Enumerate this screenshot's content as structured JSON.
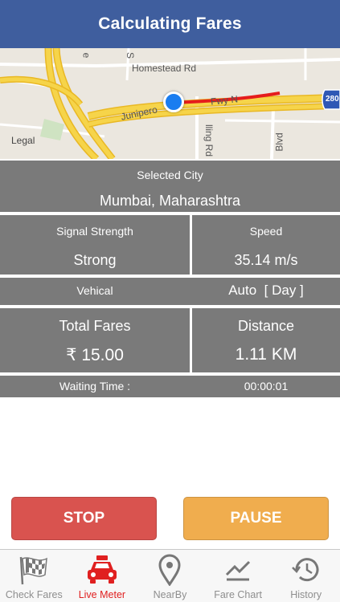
{
  "header": {
    "title": "Calculating Fares"
  },
  "map": {
    "labels": {
      "homestead": "Homestead Rd",
      "junipero": "Junipero",
      "fwy": "Fwy N",
      "rd": "lling Rd",
      "blvd": "Blvd",
      "s": "S",
      "e": "e",
      "route": "280"
    },
    "legal": "Legal"
  },
  "info": {
    "selected_city_label": "Selected City",
    "selected_city_value": "Mumbai, Maharashtra",
    "signal_label": "Signal Strength",
    "signal_value": "Strong",
    "speed_label": "Speed",
    "speed_value": "35.14 m/s",
    "vehicle_label": "Vehical",
    "vehicle_value": "Auto  [ Day ]",
    "total_fares_label": "Total Fares",
    "total_fares_value": "₹ 15.00",
    "distance_label": "Distance",
    "distance_value": "1.11 KM",
    "waiting_label": "Waiting Time :",
    "waiting_value": "00:00:01"
  },
  "buttons": {
    "stop": "STOP",
    "pause": "PAUSE"
  },
  "tabs": [
    {
      "label": "Check Fares",
      "icon": "checkered-flag-icon"
    },
    {
      "label": "Live Meter",
      "icon": "taxi-icon",
      "active": true
    },
    {
      "label": "NearBy",
      "icon": "location-pin-icon"
    },
    {
      "label": "Fare Chart",
      "icon": "chart-icon"
    },
    {
      "label": "History",
      "icon": "history-clock-icon"
    }
  ],
  "colors": {
    "header": "#3f5e9e",
    "cell": "#7a7a7a",
    "stop": "#d9534f",
    "pause": "#f0ad4e",
    "active_tab": "#e02020",
    "inactive_tab": "#8e8e8e"
  }
}
